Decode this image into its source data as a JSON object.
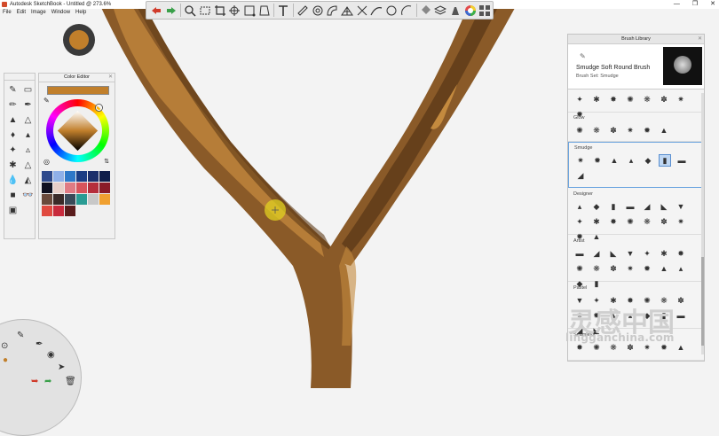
{
  "window": {
    "title": "Autodesk SketchBook - Untitled @ 273.6%",
    "controls": [
      "—",
      "❐",
      "✕"
    ]
  },
  "menu": [
    "File",
    "Edit",
    "Image",
    "Window",
    "Help"
  ],
  "toolbar": {
    "tools": [
      "undo-icon",
      "redo-icon",
      "zoom-icon",
      "select-icon",
      "crop-icon",
      "transform-icon",
      "distort-icon",
      "perspective-icon",
      "text-icon",
      "ruler-icon",
      "ellipse-icon",
      "french-curve-icon",
      "perspective-grid-icon",
      "symmetry-icon",
      "stroke-icon",
      "shape-icon",
      "guides-icon",
      "fill-icon",
      "layer-icon",
      "brush-library-icon",
      "color-wheel-icon",
      "palette-icon"
    ]
  },
  "brush_puck": {
    "color": "#c17f2b"
  },
  "color_editor": {
    "title": "Color Editor",
    "current_color": "#c17f2b",
    "swatches": [
      "#2e4a8c",
      "#8fb0e8",
      "#2e78c8",
      "#1b3d84",
      "#1b2f6b",
      "#0f1e4a",
      "#0f1020",
      "#e8cfc8",
      "#e07b84",
      "#d8545c",
      "#b52e3c",
      "#8a1c28",
      "#6a4a3c",
      "#3a2a28",
      "#3a4a58",
      "#2a9c94",
      "#c8c8c8",
      "#f0a030",
      "#e04a40",
      "#c82a3c",
      "#5a1c1c"
    ]
  },
  "brush_library": {
    "title": "Brush Library",
    "selected_brush": "Smudge Soft Round Brush",
    "brush_set": "Brush Set: Smudge",
    "sections": [
      {
        "name": "",
        "count": 8
      },
      {
        "name": "Glow",
        "count": 6
      },
      {
        "name": "Smudge",
        "count": 8
      },
      {
        "name": "Designer",
        "count": 16
      },
      {
        "name": "Artist",
        "count": 16
      },
      {
        "name": "Pastel",
        "count": 16
      },
      {
        "name": "Seamless",
        "count": 8
      }
    ]
  },
  "watermark": {
    "cn": "灵感中国",
    "url": "lingganchina.com"
  }
}
